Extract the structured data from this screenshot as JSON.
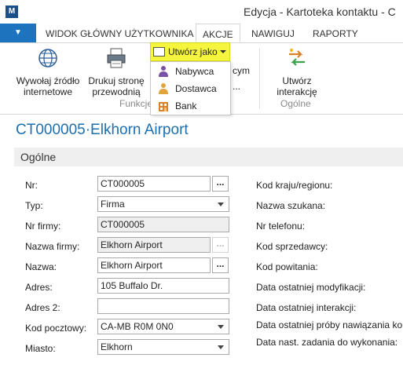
{
  "window": {
    "title": "Edycja - Kartoteka kontaktu - C"
  },
  "tabs": [
    {
      "label": "WIDOK GŁÓWNY UŻYTKOWNIKA"
    },
    {
      "label": "AKCJE"
    },
    {
      "label": "NAWIGUJ"
    },
    {
      "label": "RAPORTY"
    }
  ],
  "ribbon": {
    "browse_label": "Wywołaj źródło internetowe",
    "browse_line1": "Wywołaj źródło",
    "browse_line2": "internetowe",
    "print_line1": "Drukuj stronę",
    "print_line2": "przewodnią",
    "group_functions": "Funkcje",
    "create_as": "Utwórz jako",
    "behind_1": "cym",
    "behind_2": "...",
    "interaction_line1": "Utwórz",
    "interaction_line2": "interakcję",
    "group_general": "Ogólne"
  },
  "dropdown": {
    "items": [
      {
        "label": "Nabywca",
        "icon": "customer-icon"
      },
      {
        "label": "Dostawca",
        "icon": "vendor-icon"
      },
      {
        "label": "Bank",
        "icon": "bank-icon"
      }
    ]
  },
  "page": {
    "title": "CT000005·Elkhorn Airport"
  },
  "section": {
    "title": "Ogólne"
  },
  "fields": {
    "nr": {
      "label": "Nr:",
      "value": "CT000005"
    },
    "typ": {
      "label": "Typ:",
      "value": "Firma"
    },
    "nr_firmy": {
      "label": "Nr firmy:",
      "value": "CT000005"
    },
    "nazwa_firmy": {
      "label": "Nazwa firmy:",
      "value": "Elkhorn Airport"
    },
    "nazwa": {
      "label": "Nazwa:",
      "value": "Elkhorn Airport"
    },
    "adres": {
      "label": "Adres:",
      "value": "105 Buffalo Dr."
    },
    "adres2": {
      "label": "Adres 2:",
      "value": ""
    },
    "kod_pocztowy": {
      "label": "Kod pocztowy:",
      "value": "CA-MB R0M 0N0"
    },
    "miasto": {
      "label": "Miasto:",
      "value": "Elkhorn"
    }
  },
  "right_labels": [
    "Kod kraju/regionu:",
    "Nazwa szukana:",
    "Nr telefonu:",
    "Kod sprzedawcy:",
    "Kod powitania:",
    "Data ostatniej modyfikacji:",
    "Data ostatniej interakcji:",
    "Data ostatniej próby nawiązania kor",
    "Data nast. zadania do wykonania:"
  ],
  "colors": {
    "accent": "#1e73be",
    "highlight": "#f5f53d",
    "title": "#1e6fae"
  }
}
